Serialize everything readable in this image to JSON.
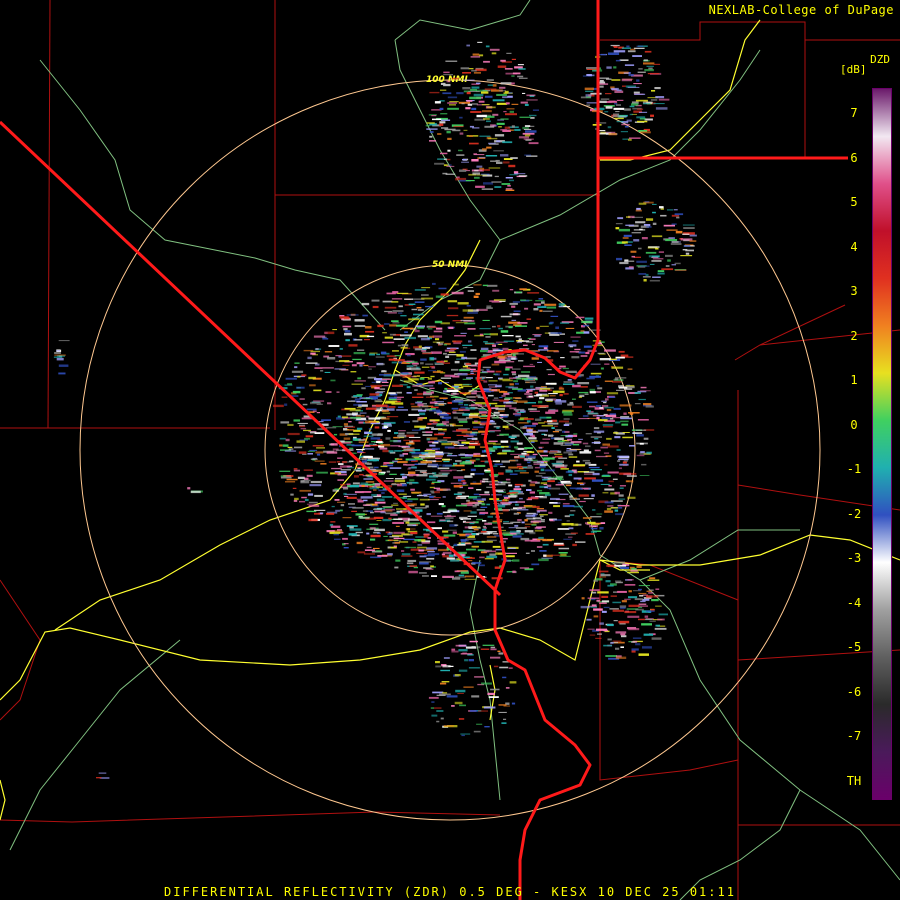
{
  "credit": "NEXLAB-College of DuPage",
  "legend": {
    "title": "DZD",
    "units": "[dB]",
    "ticks": [
      "7",
      "6",
      "5",
      "4",
      "3",
      "2",
      "1",
      "0",
      "-1",
      "-2",
      "-3",
      "-4",
      "-5",
      "-6",
      "-7",
      "TH"
    ],
    "gradient_stops": [
      "#6b1a6b",
      "#f2e8f2",
      "#e0508a",
      "#c0102a",
      "#e03020",
      "#f08020",
      "#e8e020",
      "#40d060",
      "#20b0b0",
      "#3050c0",
      "#ffffff",
      "#a0a0a0",
      "#606060",
      "#2a2a2a",
      "#4a1a5a",
      "#6a006a"
    ]
  },
  "range_rings": [
    {
      "label": "100 NMI"
    },
    {
      "label": "50 NMI"
    }
  ],
  "caption": "DIFFERENTIAL REFLECTIVITY (ZDR) 0.5 DEG - KESX 10 DEC 25 01:11",
  "colors": {
    "state_border": "#ff1a1a",
    "county_line": "#b01010",
    "highway": "#ffff30",
    "river": "#80c080",
    "ring": "#ffc890"
  }
}
